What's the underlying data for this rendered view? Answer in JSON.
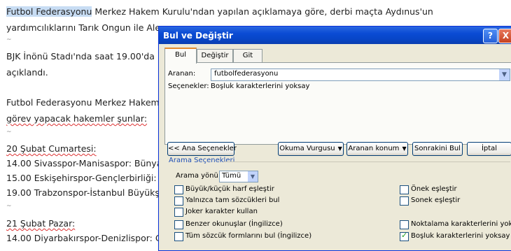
{
  "document": {
    "lines": [
      {
        "pre": "",
        "sel": "Futbol Federasyonu",
        "post": " Merkez Hakem Kurulu'ndan yapılan açıklamaya göre, derbi maçta Aydınus'un"
      },
      {
        "text": "yardımcılıklarını Tarık Ongun ile Ale"
      },
      {
        "text": "BJK İnönü Stadı'nda saat 19.00'da b"
      },
      {
        "text": "açıklandı."
      },
      {
        "text": "Futbol Federasyonu Merkez Hakem"
      },
      {
        "text": "görev yapacak hakemler şunlar:"
      },
      {
        "text": "20 Şubat Cumartesi:"
      },
      {
        "text": "14.00 Sivasspor-Manisaspor: Bünya"
      },
      {
        "text": "15.00 Eskişehirspor-Gençlerbirliği: H"
      },
      {
        "text": "19.00 Trabzonspor-İstanbul Büyükş"
      },
      {
        "text": "21 Şubat Pazar:"
      },
      {
        "text": "14.00 Diyarbakırspor-Denizlispor: C"
      }
    ]
  },
  "dialog": {
    "title": "Bul ve Değiştir",
    "help": "?",
    "close": "X",
    "tabs": [
      "Bul",
      "Değiştir",
      "Git"
    ],
    "search_label": "Aranan:",
    "search_value": "futbolfederasyonu",
    "options_label": "Seçenekler:",
    "options_value": "Boşluk karakterlerini yoksay",
    "buttons": {
      "less": "<< Ana Seçenekler",
      "reading_highlight": "Okuma Vurgusu",
      "find_in": "Aranan konum",
      "find_next": "Sonrakini Bul",
      "cancel": "İptal"
    },
    "search_options_title": "Arama Seçenekleri",
    "direction_label": "Arama yönü:",
    "direction_value": "Tümü",
    "checkboxes_left": [
      {
        "label": "Büyük/küçük harf eşleştir",
        "checked": false
      },
      {
        "label": "Yalnızca tam sözcükleri bul",
        "checked": false
      },
      {
        "label": "Joker karakter kullan",
        "checked": false
      },
      {
        "label": "Benzer okunuşlar (İngilizce)",
        "checked": false
      },
      {
        "label": "Tüm sözcük formlarını bul (İngilizce)",
        "checked": false
      }
    ],
    "checkboxes_right": [
      {
        "label": "Önek eşleştir",
        "checked": false
      },
      {
        "label": "Sonek eşleştir",
        "checked": false
      },
      {
        "label": "Noktalama karakterlerini yoksay",
        "checked": false
      },
      {
        "label": "Boşluk karakterlerini yoksay",
        "checked": true
      }
    ]
  }
}
